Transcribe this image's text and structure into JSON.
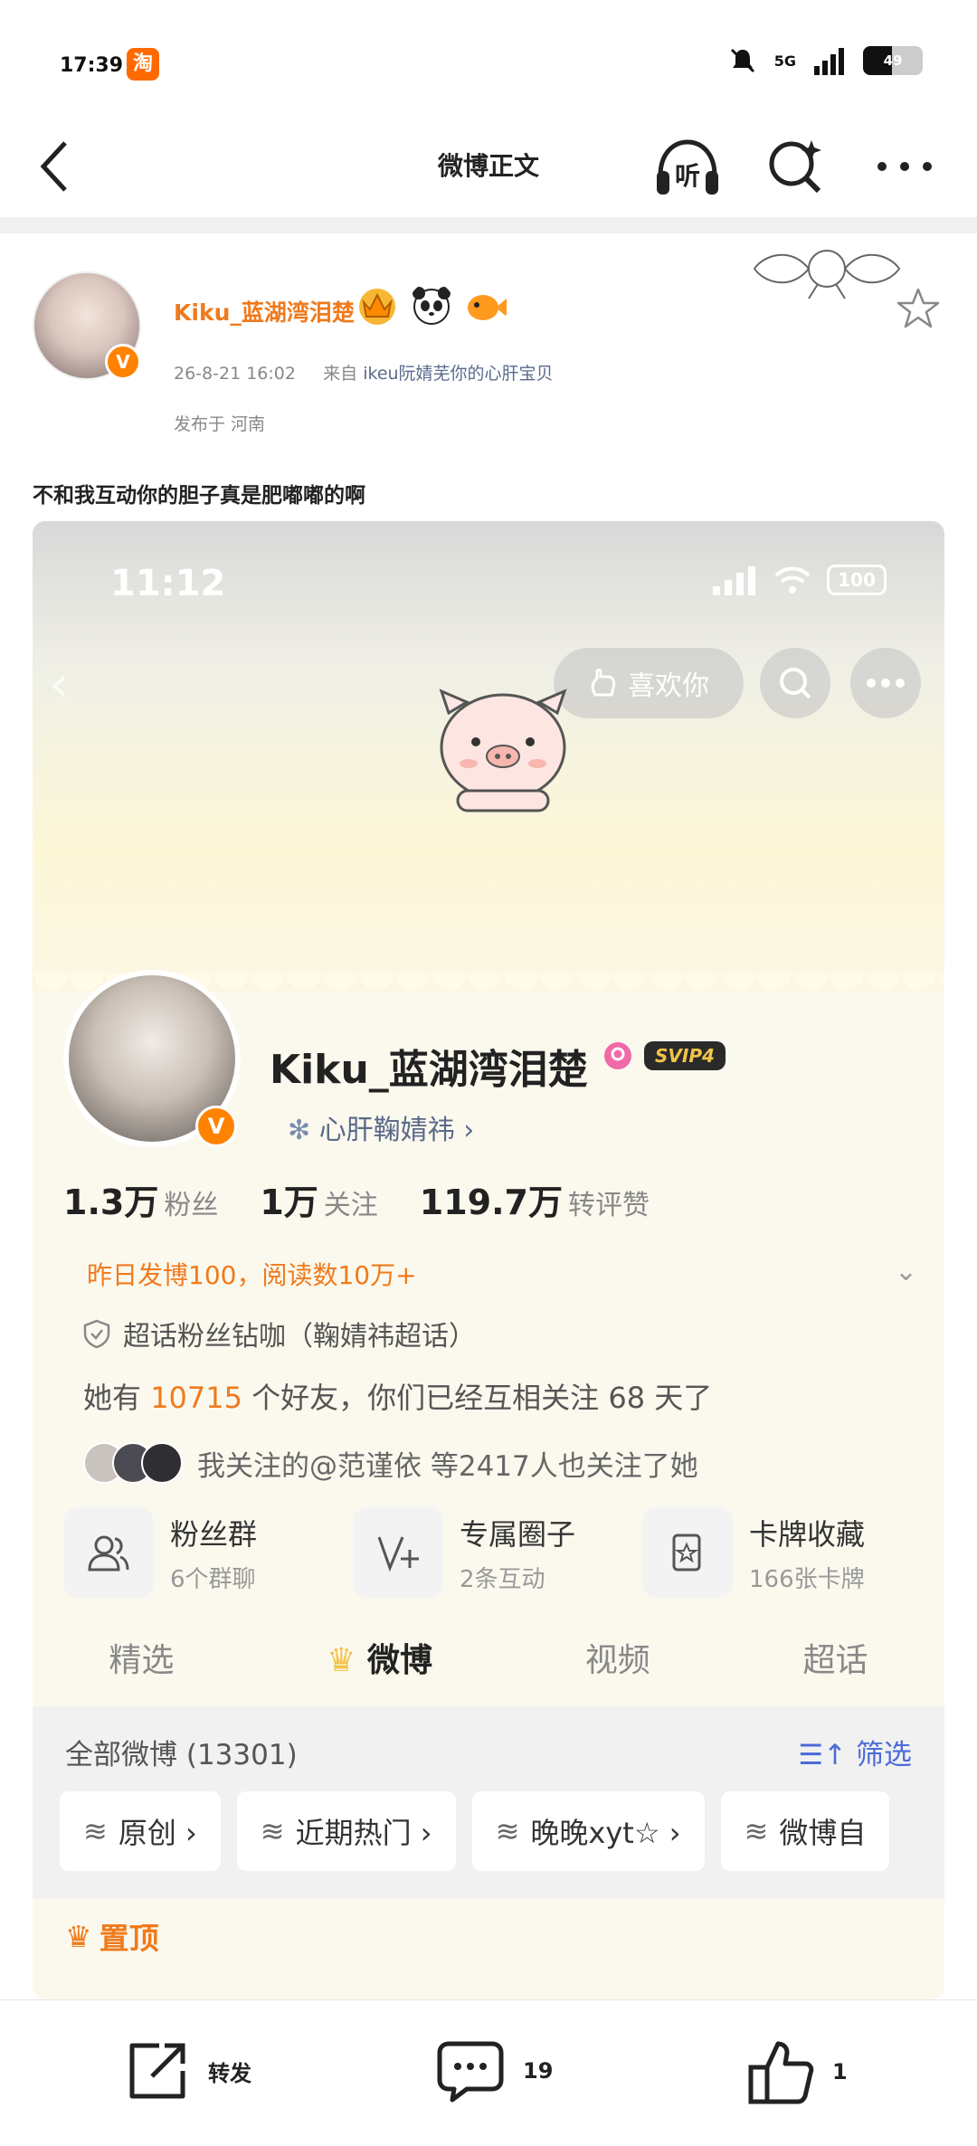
{
  "status_bar": {
    "time": "17:39",
    "app_badge": "淘",
    "network": "5G",
    "battery": "49",
    "battery_level": 0.49
  },
  "nav": {
    "title": "微博正文",
    "listen_label": "听"
  },
  "post": {
    "username": "Kiku_蓝湖湾泪楚",
    "date": "26-8-21 16:02",
    "from_prefix": "来自",
    "source": "ikeu阮婧芜你的心肝宝贝",
    "location": "发布于 河南",
    "text": "不和我互动你的胆子真是肥嘟嘟的啊"
  },
  "embed": {
    "time": "11:12",
    "battery": "100",
    "like_button": "喜欢你",
    "profile_name": "Kiku_蓝湖湾泪楚",
    "svip": "SVIP4",
    "bio": "心肝鞠婧祎 ›",
    "stats": [
      {
        "num": "1.3万",
        "label": "粉丝"
      },
      {
        "num": "1万",
        "label": "关注"
      },
      {
        "num": "119.7万",
        "label": "转评赞"
      }
    ],
    "yesterday": "昨日发博100，阅读数10万+",
    "supertalk": "超话粉丝钻咖（鞠婧祎超话）",
    "friends_prefix": "她有",
    "friends_count": "10715",
    "friends_suffix": "个好友，你们已经互相关注 68 天了",
    "mutual": "我关注的@范谨依 等2417人也关注了她",
    "cards": [
      {
        "title": "粉丝群",
        "sub": "6个群聊"
      },
      {
        "title": "专属圈子",
        "sub": "2条互动"
      },
      {
        "title": "卡牌收藏",
        "sub": "166张卡牌"
      }
    ],
    "tabs": [
      "精选",
      "微博",
      "视频",
      "超话"
    ],
    "all_weibo": "全部微博 (13301)",
    "filter": "筛选",
    "chips": [
      "原创 ›",
      "近期热门 ›",
      "晚晚xyt☆ ›",
      "微博自"
    ],
    "pinned": "置顶"
  },
  "bottom_bar": {
    "repost": "转发",
    "comment_count": "19",
    "like_count": "1"
  },
  "colors": {
    "accent_orange": "#f07a1c",
    "link_blue": "#5a6b8c",
    "filter_blue": "#4a6bd8"
  }
}
